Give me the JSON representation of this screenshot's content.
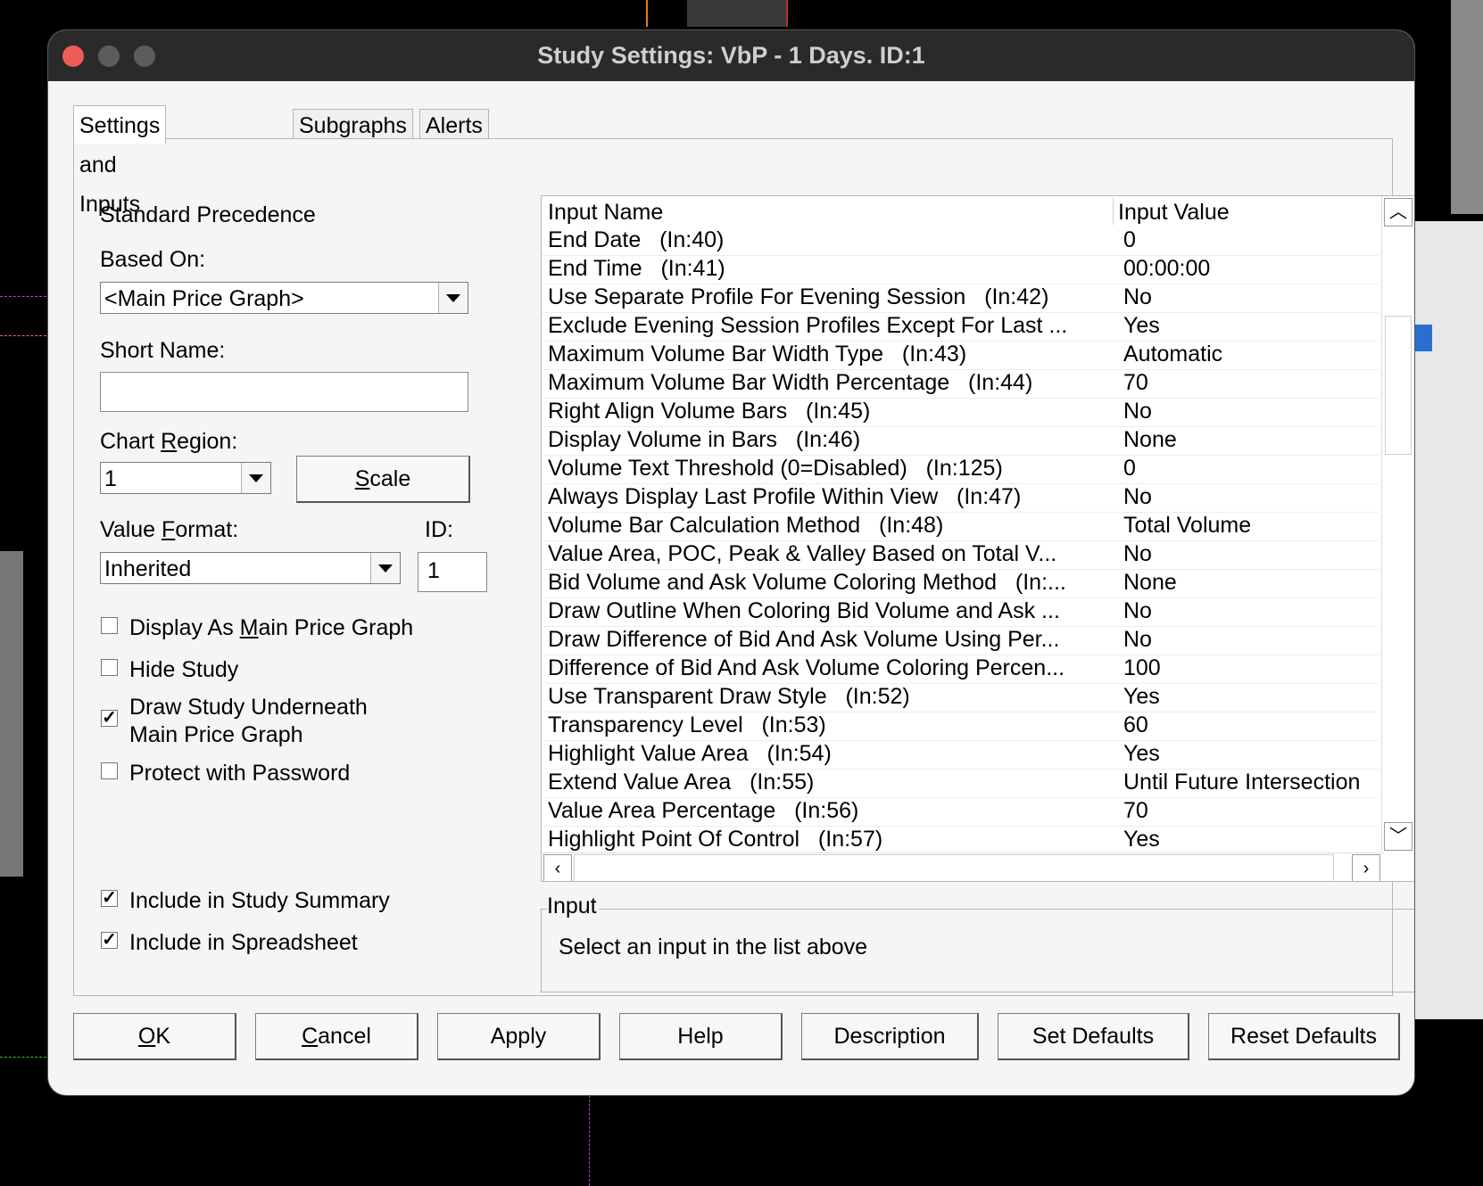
{
  "window": {
    "title": "Study Settings: VbP - 1 Days. ID:1"
  },
  "tabs": [
    "Settings and Inputs",
    "Subgraphs",
    "Alerts"
  ],
  "left": {
    "precedence": "Standard Precedence",
    "based_on_label": "Based On:",
    "based_on_value": "<Main Price Graph>",
    "short_name_label": "Short Name:",
    "short_name_value": "",
    "chart_region_label_pre": "Chart ",
    "chart_region_label_u": "R",
    "chart_region_label_post": "egion:",
    "chart_region_value": "1",
    "scale_u": "S",
    "scale_rest": "cale",
    "value_format_label_pre": "Value ",
    "value_format_label_u": "F",
    "value_format_label_post": "ormat:",
    "value_format_value": "Inherited",
    "id_label": "ID:",
    "id_value": "1",
    "chk_display_pre": "Display As ",
    "chk_display_u": "M",
    "chk_display_post": "ain Price Graph",
    "chk_display_checked": "",
    "chk_hide": "Hide Study",
    "chk_hide_checked": "",
    "chk_under_line1": "Draw Study Underneath",
    "chk_under_line2": "Main Price Graph",
    "chk_under_checked": "✓",
    "chk_protect": "Protect with Password",
    "chk_protect_checked": "",
    "chk_summary": "Include in Study Summary",
    "chk_summary_checked": "✓",
    "chk_spreadsheet": "Include in Spreadsheet",
    "chk_spreadsheet_checked": "✓"
  },
  "list": {
    "header_name": "Input Name",
    "header_value": "Input Value",
    "rows": [
      {
        "name": "End Date   (In:40)",
        "value": "0"
      },
      {
        "name": "End Time   (In:41)",
        "value": "00:00:00"
      },
      {
        "name": "Use Separate Profile For Evening Session   (In:42)",
        "value": "No"
      },
      {
        "name": "Exclude Evening Session Profiles Except For Last ...",
        "value": "Yes"
      },
      {
        "name": "Maximum Volume Bar Width Type   (In:43)",
        "value": "Automatic"
      },
      {
        "name": "Maximum Volume Bar Width Percentage   (In:44)",
        "value": "70"
      },
      {
        "name": "Right Align Volume Bars   (In:45)",
        "value": "No"
      },
      {
        "name": "Display Volume in Bars   (In:46)",
        "value": "None"
      },
      {
        "name": "Volume Text Threshold (0=Disabled)   (In:125)",
        "value": "0"
      },
      {
        "name": "Always Display Last Profile Within View   (In:47)",
        "value": "No"
      },
      {
        "name": "Volume Bar Calculation Method   (In:48)",
        "value": "Total Volume"
      },
      {
        "name": "Value Area, POC, Peak & Valley Based on Total V...",
        "value": "No"
      },
      {
        "name": "Bid Volume and Ask Volume Coloring Method   (In:...",
        "value": "None"
      },
      {
        "name": "Draw Outline When Coloring Bid Volume and Ask ...",
        "value": "No"
      },
      {
        "name": "Draw Difference of Bid And Ask Volume Using Per...",
        "value": "No"
      },
      {
        "name": "Difference of Bid And Ask Volume Coloring Percen...",
        "value": "100"
      },
      {
        "name": "Use Transparent Draw Style   (In:52)",
        "value": "Yes"
      },
      {
        "name": "Transparency Level   (In:53)",
        "value": "60"
      },
      {
        "name": "Highlight Value Area   (In:54)",
        "value": "Yes"
      },
      {
        "name": "Extend Value Area   (In:55)",
        "value": "Until Future Intersection"
      },
      {
        "name": "Value Area Percentage   (In:56)",
        "value": "70"
      },
      {
        "name": "Highlight Point Of Control   (In:57)",
        "value": "Yes"
      }
    ]
  },
  "input_group": {
    "title": "Input",
    "description": "Select an input in the list above"
  },
  "buttons": {
    "ok_u": "O",
    "ok_rest": "K",
    "cancel_u": "C",
    "cancel_rest": "ancel",
    "apply": "Apply",
    "help": "Help",
    "description": "Description",
    "set_defaults": "Set Defaults",
    "reset_defaults": "Reset Defaults"
  },
  "colors": {
    "close": "#ee5d58",
    "background": "#000000",
    "dialog": "#f5f5f5"
  }
}
